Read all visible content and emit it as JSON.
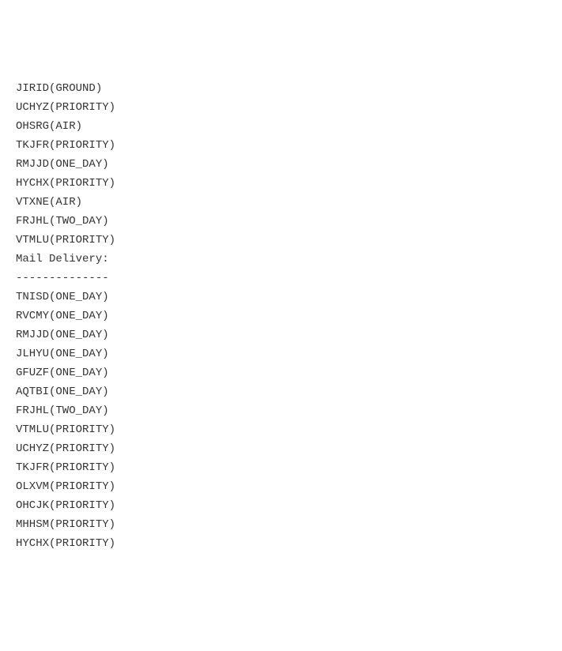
{
  "top_lines": [
    "JIRID(GROUND)",
    "UCHYZ(PRIORITY)",
    "OHSRG(AIR)",
    "TKJFR(PRIORITY)",
    "RMJJD(ONE_DAY)",
    "HYCHX(PRIORITY)",
    "VTXNE(AIR)",
    "FRJHL(TWO_DAY)",
    "VTMLU(PRIORITY)"
  ],
  "section_header": "Mail Delivery:",
  "section_rule": "--------------",
  "bottom_lines": [
    "TNISD(ONE_DAY)",
    "RVCMY(ONE_DAY)",
    "RMJJD(ONE_DAY)",
    "JLHYU(ONE_DAY)",
    "GFUZF(ONE_DAY)",
    "AQTBI(ONE_DAY)",
    "FRJHL(TWO_DAY)",
    "VTMLU(PRIORITY)",
    "UCHYZ(PRIORITY)",
    "TKJFR(PRIORITY)",
    "OLXVM(PRIORITY)",
    "OHCJK(PRIORITY)",
    "MHHSM(PRIORITY)",
    "HYCHX(PRIORITY)"
  ]
}
